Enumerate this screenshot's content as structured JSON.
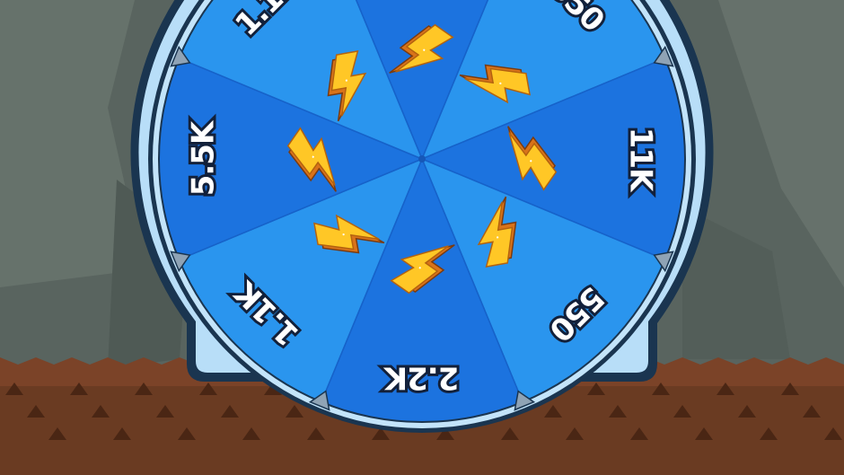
{
  "wheel": {
    "segments": [
      {
        "label": "",
        "reward_icon": "lightning-bolt-icon"
      },
      {
        "label": "550",
        "reward_icon": "lightning-bolt-icon"
      },
      {
        "label": "11K",
        "reward_icon": "lightning-bolt-icon"
      },
      {
        "label": "550",
        "reward_icon": "lightning-bolt-icon"
      },
      {
        "label": "2.2K",
        "reward_icon": "lightning-bolt-icon"
      },
      {
        "label": "1.1K",
        "reward_icon": "lightning-bolt-icon"
      },
      {
        "label": "5.5K",
        "reward_icon": "lightning-bolt-icon"
      },
      {
        "label": "1.1K",
        "reward_icon": "lightning-bolt-icon"
      }
    ],
    "colors": {
      "segment_dark": "#1c73df",
      "segment_light": "#2a95ee",
      "rim": "#b4dcf7",
      "rim_outline": "#1a3550",
      "bolt": "#ffc726",
      "bolt_shadow": "#d9731a"
    }
  },
  "background": {
    "cave_wall": "#5b6661",
    "rock": "#6f7b74",
    "ground": "#6e3e25"
  }
}
